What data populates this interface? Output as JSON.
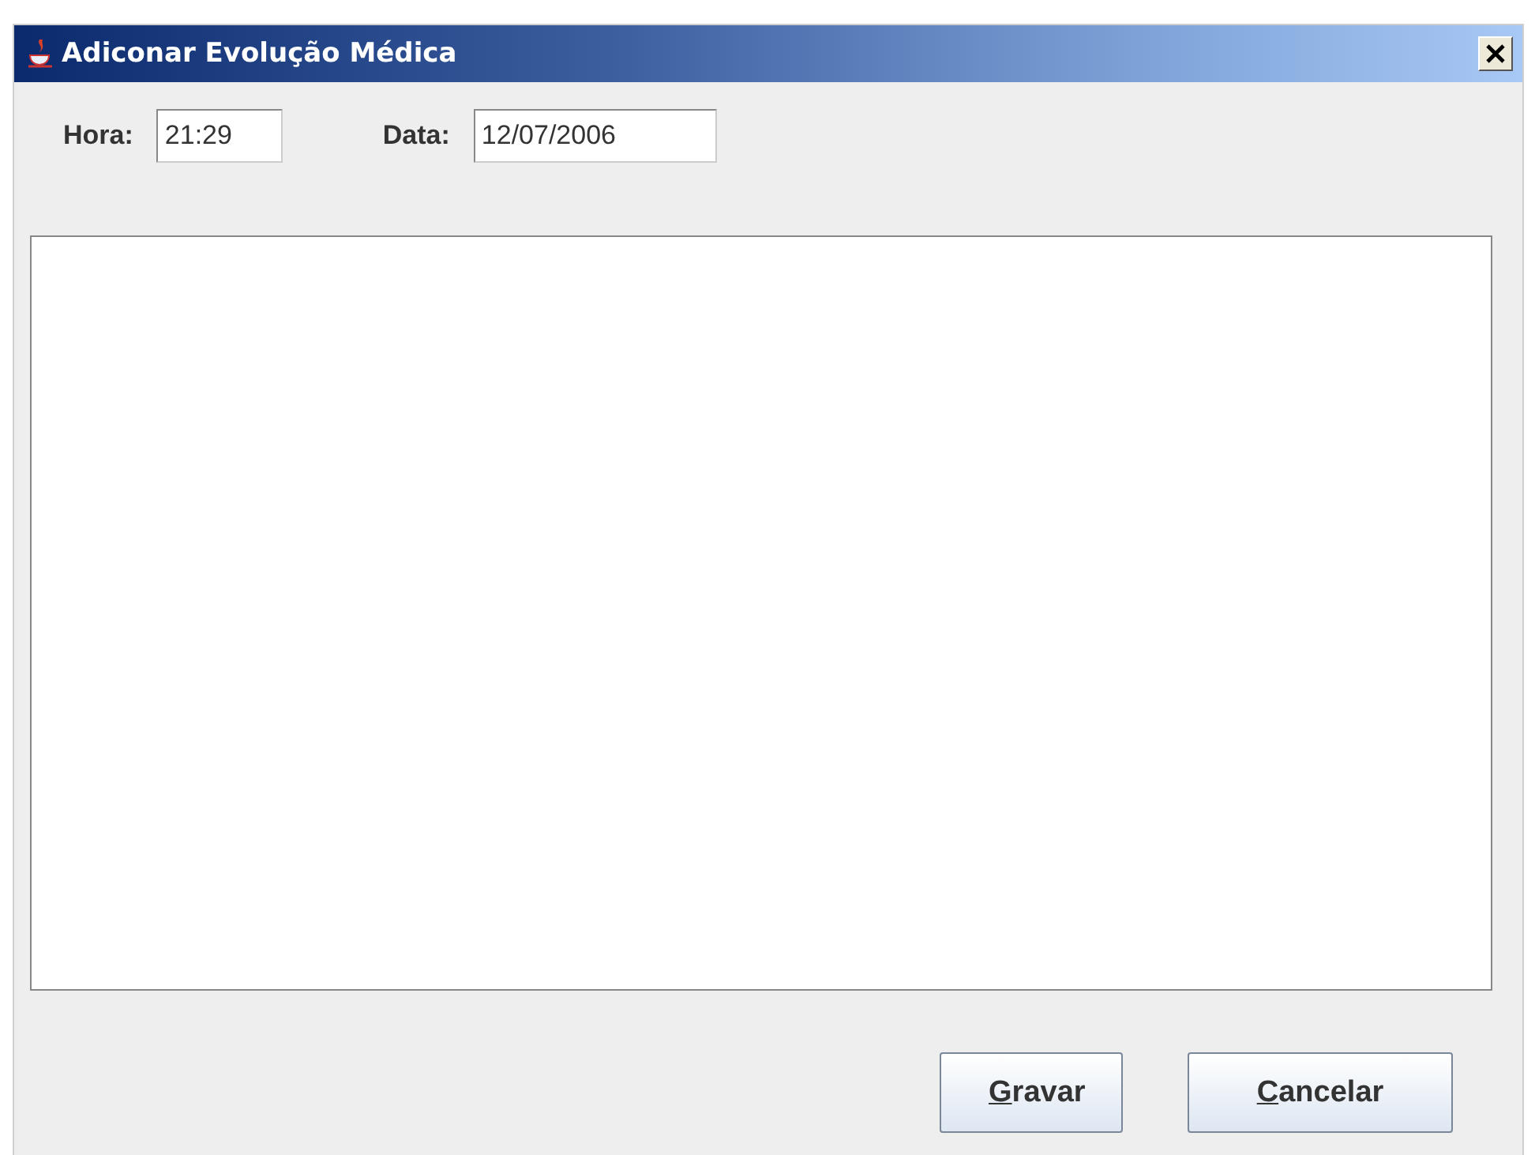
{
  "window": {
    "title": "Adiconar Evolução Médica"
  },
  "fields": [
    {
      "label": "Hora:",
      "value": "21:29",
      "kind": "short"
    },
    {
      "label": "Data:",
      "value": "12/07/2006",
      "kind": "long"
    }
  ],
  "buttons": [
    {
      "label": "Gravar"
    },
    {
      "label": "Cancelar"
    }
  ]
}
